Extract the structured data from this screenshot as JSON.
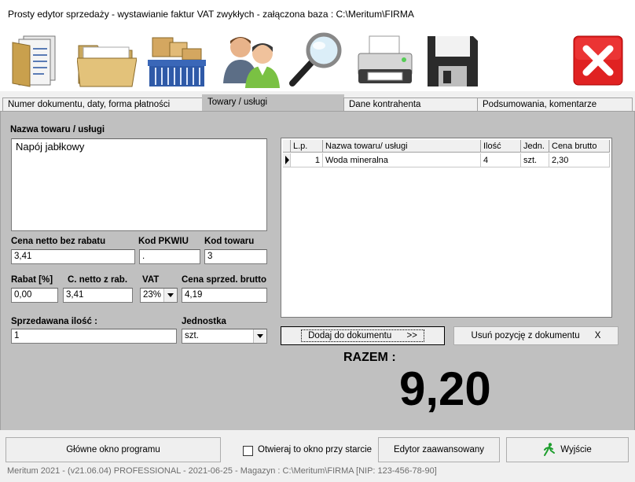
{
  "window": {
    "title": "Prosty edytor sprzedaży - wystawianie faktur VAT zwykłych   -  załączona baza : C:\\Meritum\\FIRMA"
  },
  "toolbar": {
    "icons": [
      "document-icon",
      "folder-icon",
      "goods-basket-icon",
      "contractors-icon",
      "magnifier-icon",
      "printer-icon",
      "floppy-save-icon",
      "close-red-icon"
    ]
  },
  "tabs": [
    {
      "label": "Numer dokumentu, daty, forma płatności"
    },
    {
      "label": "Towary  / usługi"
    },
    {
      "label": "Dane kontrahenta"
    },
    {
      "label": "Podsumowania, komentarze"
    }
  ],
  "form": {
    "item_name_label": "Nazwa towaru / usługi",
    "item_name_value": "Napój jabłkowy",
    "net_price_label": "Cena netto bez rabatu",
    "net_price_value": "3,41",
    "pkwiu_label": "Kod PKWIU",
    "pkwiu_value": ".",
    "code_label": "Kod towaru",
    "code_value": "3",
    "discount_label": "Rabat [%]",
    "discount_value": "0,00",
    "net_after_label": "C. netto z rab.",
    "net_after_value": "3,41",
    "vat_label": "VAT",
    "vat_value": "23%",
    "gross_label": "Cena sprzed. brutto",
    "gross_value": "4,19",
    "qty_label": "Sprzedawana ilość :",
    "qty_value": "1",
    "unit_label": "Jednostka",
    "unit_value": "szt."
  },
  "grid": {
    "headers": [
      "L.p.",
      "Nazwa towaru/ usługi",
      "Ilość",
      "Jedn.",
      "Cena brutto"
    ],
    "rows": [
      {
        "lp": "1",
        "name": "Woda mineralna",
        "qty": "4",
        "unit": "szt.",
        "price": "2,30"
      }
    ]
  },
  "actions": {
    "add_label": "Dodaj do dokumentu",
    "add_suffix": ">>",
    "remove_label": "Usuń pozycję z dokumentu",
    "remove_suffix": "X"
  },
  "total": {
    "label": "RAZEM  :",
    "value": "9,20"
  },
  "footer": {
    "main_window_label": "Główne okno programu",
    "open_at_start_label": "Otwieraj to okno przy starcie",
    "advanced_label": "Edytor zaawansowany",
    "exit_label": "Wyjście"
  },
  "status": {
    "text": "Meritum 2021   -   (v21.06.04) PROFESSIONAL   -  2021-06-25  -  Magazyn :  C:\\Meritum\\FIRMA   [NIP: 123-456-78-90]"
  }
}
